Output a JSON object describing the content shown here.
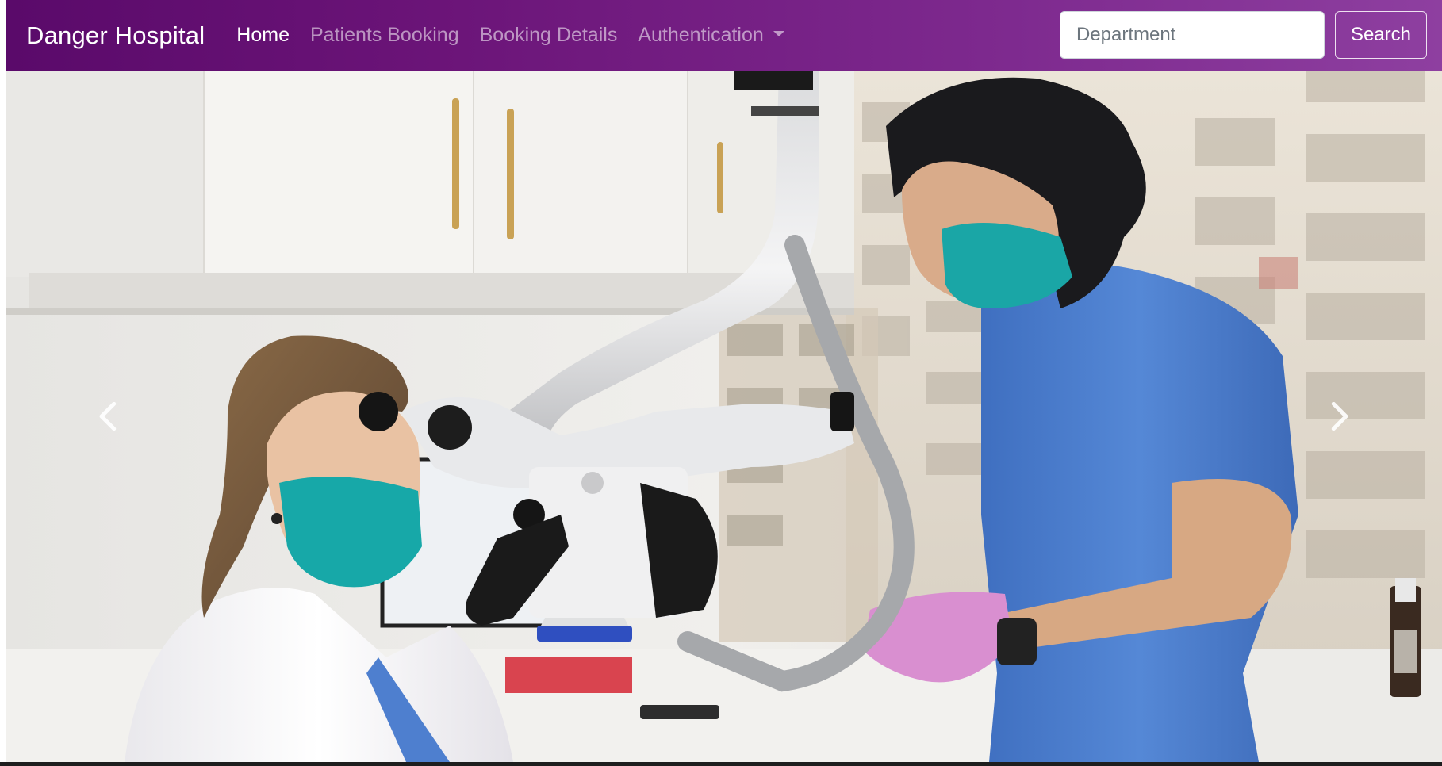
{
  "navbar": {
    "brand": "Danger Hospital",
    "links": [
      {
        "label": "Home",
        "active": true
      },
      {
        "label": "Patients Booking",
        "active": false
      },
      {
        "label": "Booking Details",
        "active": false
      },
      {
        "label": "Authentication",
        "active": false,
        "dropdown": true
      }
    ],
    "search": {
      "placeholder": "Department",
      "value": "",
      "button_label": "Search"
    }
  },
  "carousel": {
    "image_alt": "Dentist looking through dental microscope while assistant holds instruments",
    "prev_icon": "chevron-left-icon",
    "next_icon": "chevron-right-icon"
  },
  "colors": {
    "navbar_start": "#5a0a6a",
    "navbar_end": "#8e3fa0",
    "scrub_blue": "#4e7fcf",
    "mask_teal": "#1aa6a6",
    "glove_pink": "#d98fd0"
  }
}
